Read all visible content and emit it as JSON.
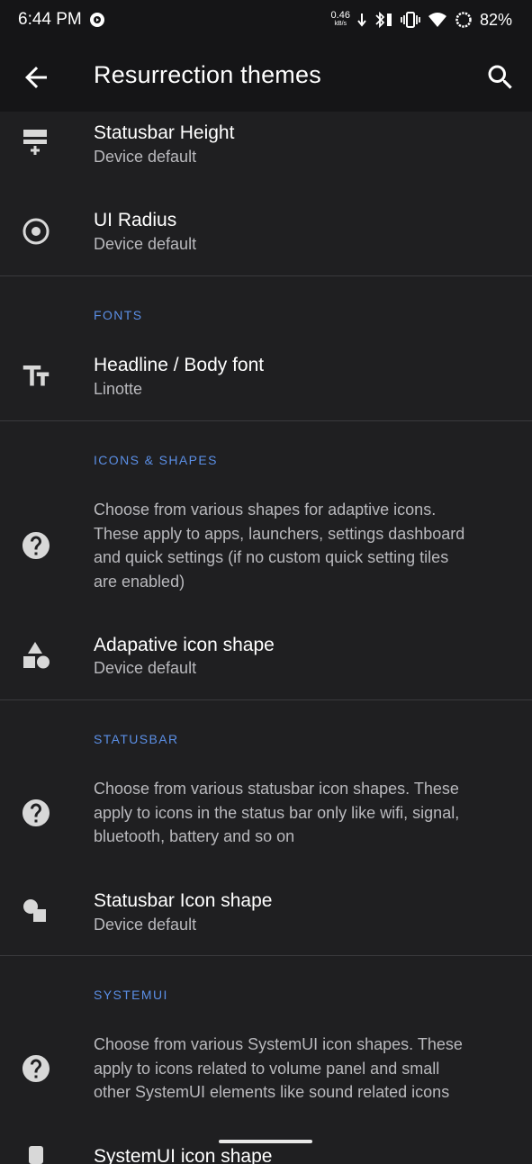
{
  "status": {
    "time": "6:44 PM",
    "net_speed_value": "0.46",
    "net_speed_unit": "kB/s",
    "battery": "82%"
  },
  "appbar": {
    "title": "Resurrection themes"
  },
  "items": {
    "statusbar_height": {
      "title": "Statusbar Height",
      "summary": "Device default"
    },
    "ui_radius": {
      "title": "UI Radius",
      "summary": "Device default"
    },
    "fonts_header": "FONTS",
    "headline_font": {
      "title": "Headline / Body font",
      "summary": "Linotte"
    },
    "icons_header": "ICONS & SHAPES",
    "icons_info": [
      "Choose from various shapes for adaptive icons.",
      "These apply to apps, launchers, settings dashboard",
      "and quick settings (if no custom quick setting tiles",
      "are enabled)"
    ],
    "adaptive_icon_shape": {
      "title": "Adapative icon shape",
      "summary": "Device default"
    },
    "statusbar_header": "STATUSBAR",
    "statusbar_info": [
      "Choose from various statusbar icon shapes. These",
      "apply to icons in the status bar only like wifi, signal,",
      "bluetooth, battery and so on"
    ],
    "statusbar_icon_shape": {
      "title": "Statusbar Icon shape",
      "summary": "Device default"
    },
    "systemui_header": "SYSTEMUI",
    "systemui_info": [
      "Choose from various SystemUI icon shapes. These",
      "apply to icons related to volume panel and small",
      "other SystemUI elements like sound related icons"
    ],
    "systemui_partial_title": "SystemUI icon shape"
  }
}
